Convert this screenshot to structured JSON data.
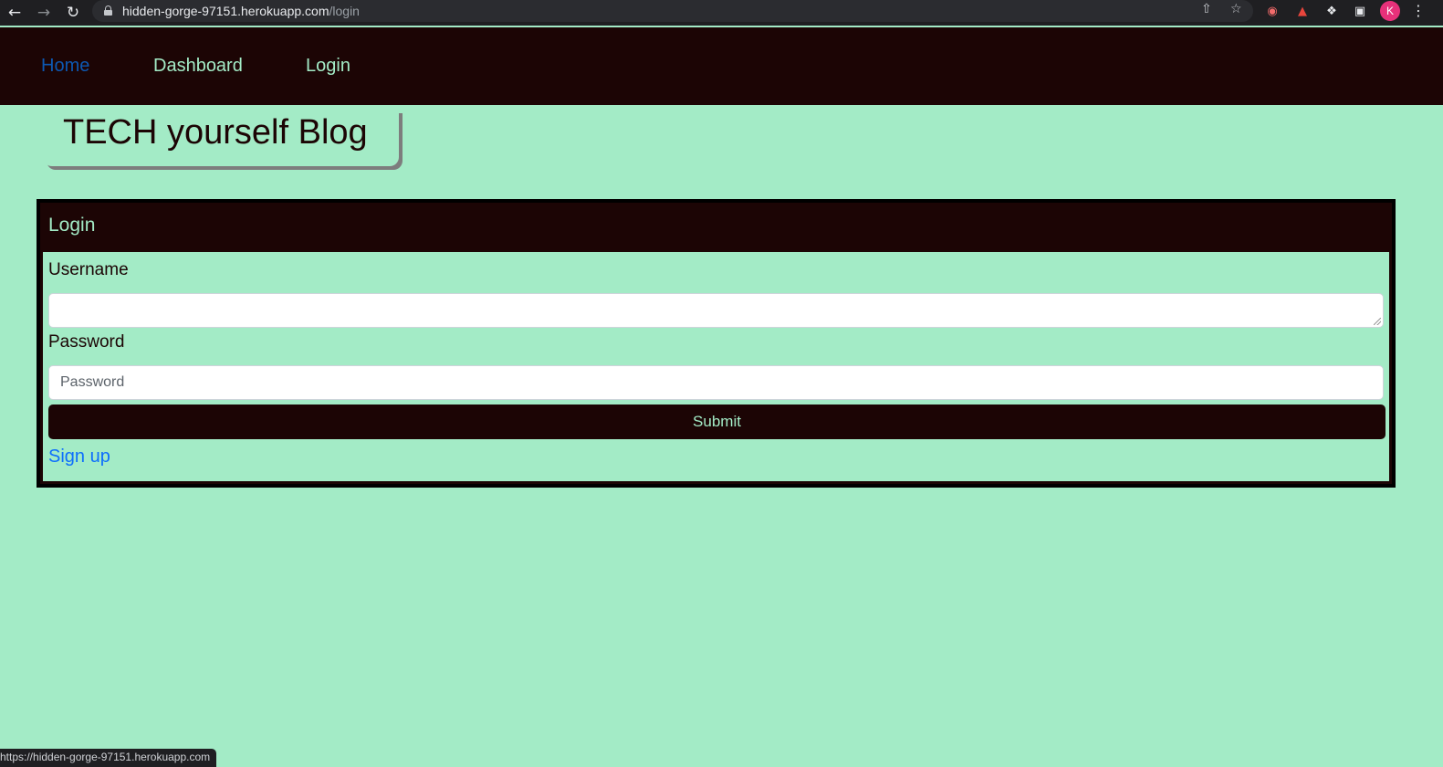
{
  "browser": {
    "url_host": "hidden-gorge-97151.herokuapp.com",
    "url_path": "/login",
    "avatar_initial": "K",
    "status_url": "https://hidden-gorge-97151.herokuapp.com",
    "icons": [
      "back-arrow-icon",
      "forward-arrow-icon",
      "reload-icon",
      "lock-icon",
      "share-icon",
      "bookmark-star-icon",
      "extension-record-icon",
      "extension-icon",
      "puzzle-extensions-icon",
      "side-panel-icon",
      "menu-dots-icon"
    ]
  },
  "nav": {
    "home": "Home",
    "dashboard": "Dashboard",
    "login": "Login"
  },
  "site": {
    "title": "TECH yourself Blog"
  },
  "login_form": {
    "header": "Login",
    "username_label": "Username",
    "username_value": "",
    "password_label": "Password",
    "password_placeholder": "Password",
    "submit_label": "Submit",
    "signup_link": "Sign up"
  },
  "colors": {
    "background": "#a3ebc6",
    "dark": "#1c0505",
    "active_link": "#0d58b2",
    "signup_link": "#0d6efd"
  }
}
